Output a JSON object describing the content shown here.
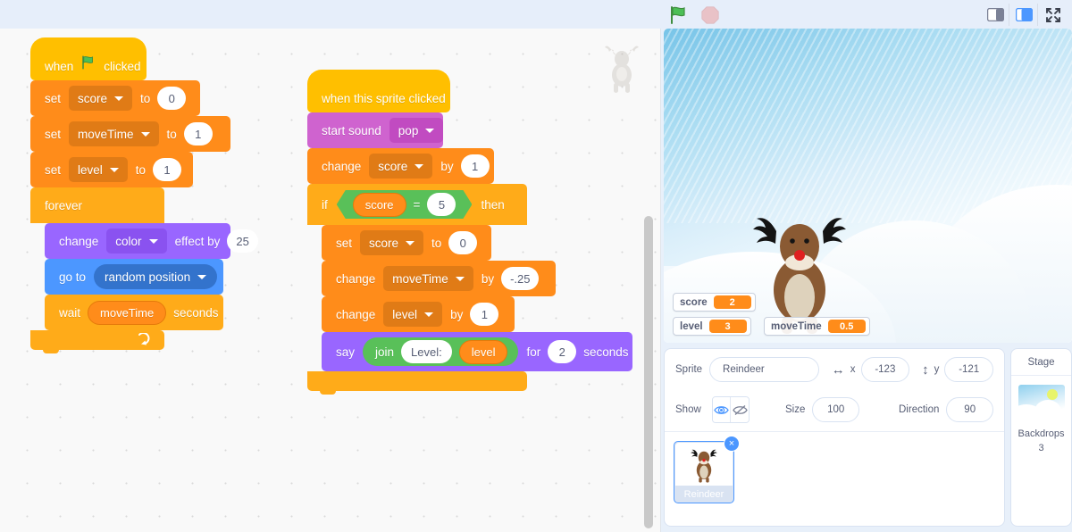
{
  "toolbar": {
    "green_flag_label": "Go",
    "stop_label": "Stop",
    "small_stage_label": "Small stage layout",
    "large_stage_label": "Large stage layout",
    "fullscreen_label": "Full screen control"
  },
  "code_area": {
    "watermark_sprite": "Reindeer",
    "scripts": [
      {
        "id": "script-flag",
        "blocks": [
          {
            "kind": "hat",
            "category": "events",
            "parts": [
              {
                "t": "label",
                "v": "when"
              },
              {
                "t": "icon",
                "v": "green-flag-icon"
              },
              {
                "t": "label",
                "v": "clicked"
              }
            ]
          },
          {
            "kind": "stack",
            "category": "variables",
            "parts": [
              {
                "t": "label",
                "v": "set"
              },
              {
                "t": "dropdown",
                "v": "score"
              },
              {
                "t": "label",
                "v": "to"
              },
              {
                "t": "num",
                "v": "0"
              }
            ]
          },
          {
            "kind": "stack",
            "category": "variables",
            "parts": [
              {
                "t": "label",
                "v": "set"
              },
              {
                "t": "dropdown",
                "v": "moveTime"
              },
              {
                "t": "label",
                "v": "to"
              },
              {
                "t": "num",
                "v": "1"
              }
            ]
          },
          {
            "kind": "stack",
            "category": "variables",
            "parts": [
              {
                "t": "label",
                "v": "set"
              },
              {
                "t": "dropdown",
                "v": "level"
              },
              {
                "t": "label",
                "v": "to"
              },
              {
                "t": "num",
                "v": "1"
              }
            ]
          },
          {
            "kind": "c",
            "category": "control",
            "parts": [
              {
                "t": "label",
                "v": "forever"
              }
            ],
            "children": [
              {
                "kind": "stack",
                "category": "looks",
                "parts": [
                  {
                    "t": "label",
                    "v": "change"
                  },
                  {
                    "t": "dropdown",
                    "v": "color"
                  },
                  {
                    "t": "label",
                    "v": "effect by"
                  },
                  {
                    "t": "num",
                    "v": "25"
                  }
                ]
              },
              {
                "kind": "stack",
                "category": "motion",
                "parts": [
                  {
                    "t": "label",
                    "v": "go to"
                  },
                  {
                    "t": "dropdown",
                    "v": "random position"
                  }
                ]
              },
              {
                "kind": "stack",
                "category": "control",
                "parts": [
                  {
                    "t": "label",
                    "v": "wait"
                  },
                  {
                    "t": "reporter",
                    "v": "moveTime"
                  },
                  {
                    "t": "label",
                    "v": "seconds"
                  }
                ]
              }
            ],
            "loop_arrow": true
          }
        ]
      },
      {
        "id": "script-sprite-clicked",
        "blocks": [
          {
            "kind": "hat",
            "category": "events",
            "parts": [
              {
                "t": "label",
                "v": "when this sprite clicked"
              }
            ]
          },
          {
            "kind": "stack",
            "category": "sound",
            "parts": [
              {
                "t": "label",
                "v": "start sound"
              },
              {
                "t": "dropdown",
                "v": "pop"
              }
            ]
          },
          {
            "kind": "stack",
            "category": "variables",
            "parts": [
              {
                "t": "label",
                "v": "change"
              },
              {
                "t": "dropdown",
                "v": "score"
              },
              {
                "t": "label",
                "v": "by"
              },
              {
                "t": "num",
                "v": "1"
              }
            ]
          },
          {
            "kind": "c",
            "category": "control",
            "parts": [
              {
                "t": "label",
                "v": "if"
              },
              {
                "t": "bool_equals",
                "left": "score",
                "op": "=",
                "right": "5"
              },
              {
                "t": "label",
                "v": "then"
              }
            ],
            "children": [
              {
                "kind": "stack",
                "category": "variables",
                "parts": [
                  {
                    "t": "label",
                    "v": "set"
                  },
                  {
                    "t": "dropdown",
                    "v": "score"
                  },
                  {
                    "t": "label",
                    "v": "to"
                  },
                  {
                    "t": "num",
                    "v": "0"
                  }
                ]
              },
              {
                "kind": "stack",
                "category": "variables",
                "parts": [
                  {
                    "t": "label",
                    "v": "change"
                  },
                  {
                    "t": "dropdown",
                    "v": "moveTime"
                  },
                  {
                    "t": "label",
                    "v": "by"
                  },
                  {
                    "t": "num",
                    "v": "-.25"
                  }
                ]
              },
              {
                "kind": "stack",
                "category": "variables",
                "parts": [
                  {
                    "t": "label",
                    "v": "change"
                  },
                  {
                    "t": "dropdown",
                    "v": "level"
                  },
                  {
                    "t": "label",
                    "v": "by"
                  },
                  {
                    "t": "num",
                    "v": "1"
                  }
                ]
              },
              {
                "kind": "stack",
                "category": "looks",
                "parts": [
                  {
                    "t": "label",
                    "v": "say"
                  },
                  {
                    "t": "join",
                    "op": "join",
                    "text": "Level:",
                    "reporter": "level"
                  },
                  {
                    "t": "label",
                    "v": "for"
                  },
                  {
                    "t": "num",
                    "v": "2"
                  },
                  {
                    "t": "label",
                    "v": "seconds"
                  }
                ]
              }
            ],
            "loop_arrow": false
          }
        ]
      }
    ],
    "labels": {
      "when": "when",
      "clicked": "clicked",
      "when_sprite_clicked": "when this sprite clicked",
      "set": "set",
      "change": "change",
      "to": "to",
      "by": "by",
      "forever": "forever",
      "effect_by": "effect by",
      "go_to": "go to",
      "wait": "wait",
      "seconds": "seconds",
      "start_sound": "start sound",
      "if": "if",
      "then": "then",
      "say": "say",
      "join": "join",
      "for": "for"
    },
    "values": {
      "score_var": "score",
      "moveTime_var": "moveTime",
      "level_var": "level",
      "color_effect": "color",
      "random_position": "random position",
      "pop_sound": "pop",
      "zero": "0",
      "one": "1",
      "two": "2",
      "five": "5",
      "twentyfive": "25",
      "neg_quarter": "-.25",
      "equals": "=",
      "level_text": "Level:"
    }
  },
  "stage": {
    "monitors": [
      {
        "name": "score",
        "value": "2"
      },
      {
        "name": "level",
        "value": "3"
      },
      {
        "name": "moveTime",
        "value": "0.5"
      }
    ],
    "sprite_on_stage": "Reindeer"
  },
  "sprite_info": {
    "sprite_label": "Sprite",
    "sprite_name": "Reindeer",
    "x_label": "x",
    "x_value": "-123",
    "y_label": "y",
    "y_value": "-121",
    "show_label": "Show",
    "size_label": "Size",
    "size_value": "100",
    "direction_label": "Direction",
    "direction_value": "90",
    "show_visible_icon": "eye-icon",
    "show_hidden_icon": "eye-slash-icon",
    "delete_badge": "×"
  },
  "sprite_list": [
    {
      "name": "Reindeer",
      "selected": true
    }
  ],
  "stage_selector": {
    "header": "Stage",
    "caption": "Backdrops",
    "count": "3"
  },
  "colors": {
    "events": "#ffbf00",
    "variables": "#ff8c1a",
    "control": "#ffab19",
    "looks": "#9966ff",
    "motion": "#4c97ff",
    "sound": "#cf63cf",
    "operators": "#59c059",
    "accent": "#4c97ff",
    "sun": "#e8f46a"
  }
}
